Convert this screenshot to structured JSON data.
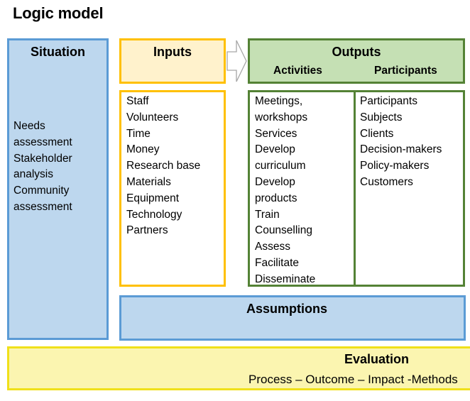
{
  "title": "Logic model",
  "situation": {
    "header": "Situation",
    "items": [
      "Needs",
      "assessment",
      "Stakeholder",
      "analysis",
      "Community",
      "assessment"
    ]
  },
  "inputs": {
    "header": "Inputs",
    "items": [
      "Staff",
      "Volunteers",
      "Time",
      "Money",
      "Research base",
      "Materials",
      "Equipment",
      "Technology",
      "Partners"
    ]
  },
  "arrow_icon": "right-arrow-icon",
  "outputs": {
    "header": "Outputs",
    "activities_header": "Activities",
    "participants_header": "Participants",
    "activities": [
      "Meetings,",
      "workshops",
      "Services",
      "Develop",
      "curriculum",
      "Develop",
      "products",
      "Train",
      "Counselling",
      "Assess",
      "Facilitate",
      "Disseminate"
    ],
    "participants": [
      "Participants",
      "Subjects",
      "Clients",
      "Decision-makers",
      "Policy-makers",
      "Customers"
    ]
  },
  "assumptions": {
    "header": "Assumptions"
  },
  "evaluation": {
    "header": "Evaluation",
    "methods": "Process – Outcome – Impact -Methods"
  },
  "colors": {
    "situation_fill": "#bdd7ee",
    "situation_border": "#5b9bd5",
    "inputs_fill": "#fff2cc",
    "inputs_border": "#ffc000",
    "outputs_fill": "#c5e0b4",
    "outputs_border": "#548235",
    "evaluation_fill": "#fbf5b0",
    "evaluation_border": "#f0e01a"
  }
}
